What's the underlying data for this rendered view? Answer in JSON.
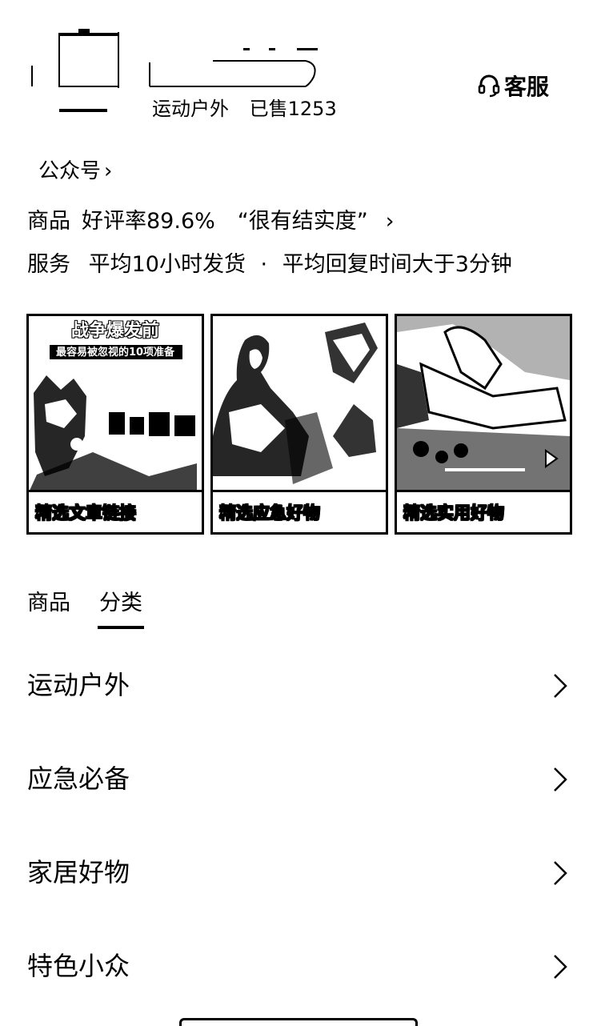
{
  "shop": {
    "category": "运动户外",
    "sold": "已售1253",
    "service_label": "客服"
  },
  "official_account": {
    "label": "公众号",
    "chevron": "›"
  },
  "rating": {
    "label": "商品",
    "text": "好评率89.6%",
    "quote": "“很有结实度”",
    "chevron": "›"
  },
  "service": {
    "label": "服务",
    "ship": "平均10小时发货",
    "dot": "·",
    "reply": "平均回复时间大于3分钟"
  },
  "cards": [
    {
      "banner_title": "战争爆发前",
      "banner_sub": "最容易被忽视的10项准备",
      "caption": "精选文章链接"
    },
    {
      "caption": "精选应急好物"
    },
    {
      "caption": "精选实用好物"
    }
  ],
  "tabs": [
    {
      "label": "商品",
      "active": false
    },
    {
      "label": "分类",
      "active": true
    }
  ],
  "categories": [
    {
      "label": "运动户外"
    },
    {
      "label": "应急必备"
    },
    {
      "label": "家居好物"
    },
    {
      "label": "特色小众"
    }
  ],
  "icons": {
    "service": "headset-icon",
    "chevron": "chevron-right-icon"
  }
}
